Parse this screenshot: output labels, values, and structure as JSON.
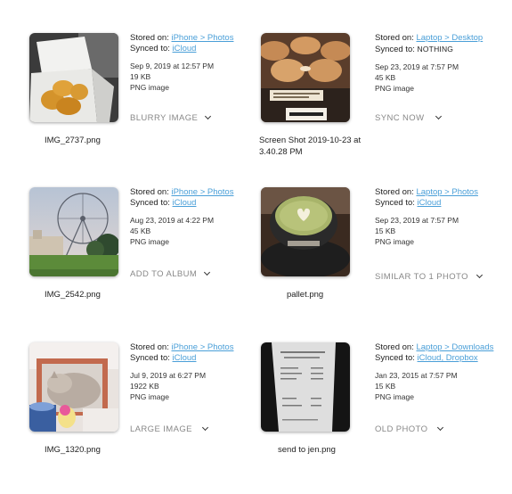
{
  "files": [
    {
      "name": "IMG_2737.png",
      "stored_on_label": "Stored on:",
      "stored_on": "iPhone > Photos",
      "synced_to_label": "Synced to:",
      "synced_to": "iCloud",
      "synced_to_is_link": true,
      "date": "Sep 9, 2019 at 12:57 PM",
      "size": "19 KB",
      "type": "PNG image",
      "action": "BLURRY IMAGE",
      "thumbnail_icon": "chicken-nuggets-photo"
    },
    {
      "name": "Screen Shot 2019-10-23 at 3.40.28 PM",
      "stored_on_label": "Stored on:",
      "stored_on": "Laptop > Desktop",
      "synced_to_label": "Synced to:",
      "synced_to": "NOTHING",
      "synced_to_is_link": false,
      "date": "Sep 23, 2019 at 7:57 PM",
      "size": "45 KB",
      "type": "PNG image",
      "action": "SYNC NOW",
      "thumbnail_icon": "pastries-photo"
    },
    {
      "name": "IMG_2542.png",
      "stored_on_label": "Stored on:",
      "stored_on": "iPhone > Photos",
      "synced_to_label": "Synced to:",
      "synced_to": "iCloud",
      "synced_to_is_link": true,
      "date": "Aug 23, 2019 at 4:22 PM",
      "size": "45 KB",
      "type": "PNG image",
      "action": "ADD TO ALBUM",
      "thumbnail_icon": "ferris-wheel-photo"
    },
    {
      "name": "pallet.png",
      "stored_on_label": "Stored on:",
      "stored_on": "Laptop > Photos",
      "synced_to_label": "Synced to:",
      "synced_to": "iCloud",
      "synced_to_is_link": true,
      "date": "Sep 23, 2019 at 7:57 PM",
      "size": "15 KB",
      "type": "PNG image",
      "action": "SIMILAR TO 1 PHOTO",
      "thumbnail_icon": "latte-photo"
    },
    {
      "name": "IMG_1320.png",
      "stored_on_label": "Stored on:",
      "stored_on": "iPhone > Photos",
      "synced_to_label": "Synced to:",
      "synced_to": "iCloud",
      "synced_to_is_link": true,
      "date": "Jul 9, 2019 at 6:27 PM",
      "size": "1922 KB",
      "type": "PNG image",
      "action": "LARGE IMAGE",
      "thumbnail_icon": "cat-photo"
    },
    {
      "name": "send to jen.png",
      "stored_on_label": "Stored on:",
      "stored_on": "Laptop > Downloads",
      "synced_to_label": "Synced to:",
      "synced_to": "iCloud, Dropbox",
      "synced_to_is_link": true,
      "date": "Jan 23, 2015 at 7:57 PM",
      "size": "15 KB",
      "type": "PNG image",
      "action": "OLD PHOTO",
      "thumbnail_icon": "receipt-photo"
    }
  ],
  "colors": {
    "link": "#4a9fd8",
    "action": "#888888"
  }
}
